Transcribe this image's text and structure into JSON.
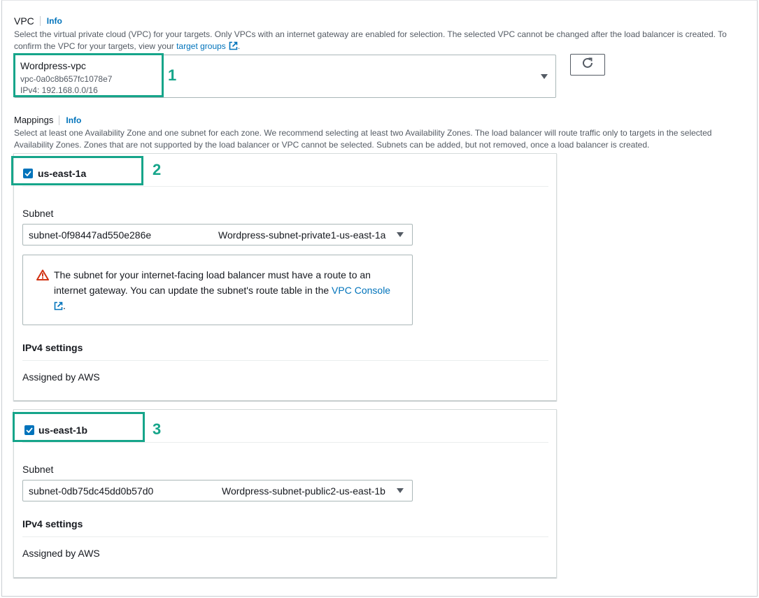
{
  "vpc": {
    "label": "VPC",
    "info": "Info",
    "description_1": "Select the virtual private cloud (VPC) for your targets. Only VPCs with an internet gateway are enabled for selection. The selected VPC cannot be changed after the load balancer is created. To",
    "description_2": "confirm the VPC for your targets, view your",
    "target_groups_link": "target groups",
    "description_end": ".",
    "selected_name": "Wordpress-vpc",
    "selected_id": "vpc-0a0c8b657fc1078e7",
    "selected_cidr": "IPv4: 192.168.0.0/16",
    "annotation": "1"
  },
  "mappings": {
    "label": "Mappings",
    "info": "Info",
    "description_1": "Select at least one Availability Zone and one subnet for each zone. We recommend selecting at least two Availability Zones. The load balancer will route traffic only to targets in the selected",
    "description_2": "Availability Zones. Zones that are not supported by the load balancer or VPC cannot be selected. Subnets can be added, but not removed, once a load balancer is created."
  },
  "zones": [
    {
      "name": "us-east-1a",
      "annotation": "2",
      "subnet_label": "Subnet",
      "subnet_id": "subnet-0f98447ad550e286e",
      "subnet_name": "Wordpress-subnet-private1-us-east-1a",
      "warning_1": "The subnet for your internet-facing load balancer must have a route to an",
      "warning_2": "internet gateway. You can update the subnet's route table in the",
      "warning_link": "VPC Console",
      "warning_end": ".",
      "ipv4_label": "IPv4 settings",
      "ipv4_value": "Assigned by AWS"
    },
    {
      "name": "us-east-1b",
      "annotation": "3",
      "subnet_label": "Subnet",
      "subnet_id": "subnet-0db75dc45dd0b57d0",
      "subnet_name": "Wordpress-subnet-public2-us-east-1b",
      "ipv4_label": "IPv4 settings",
      "ipv4_value": "Assigned by AWS"
    }
  ],
  "colors": {
    "accent": "#0073bb",
    "highlight": "#16a58a",
    "warning": "#d13212"
  },
  "icons": [
    "external-link-icon",
    "caret-down-icon",
    "refresh-icon",
    "checkbox-checked-icon",
    "warning-icon"
  ]
}
